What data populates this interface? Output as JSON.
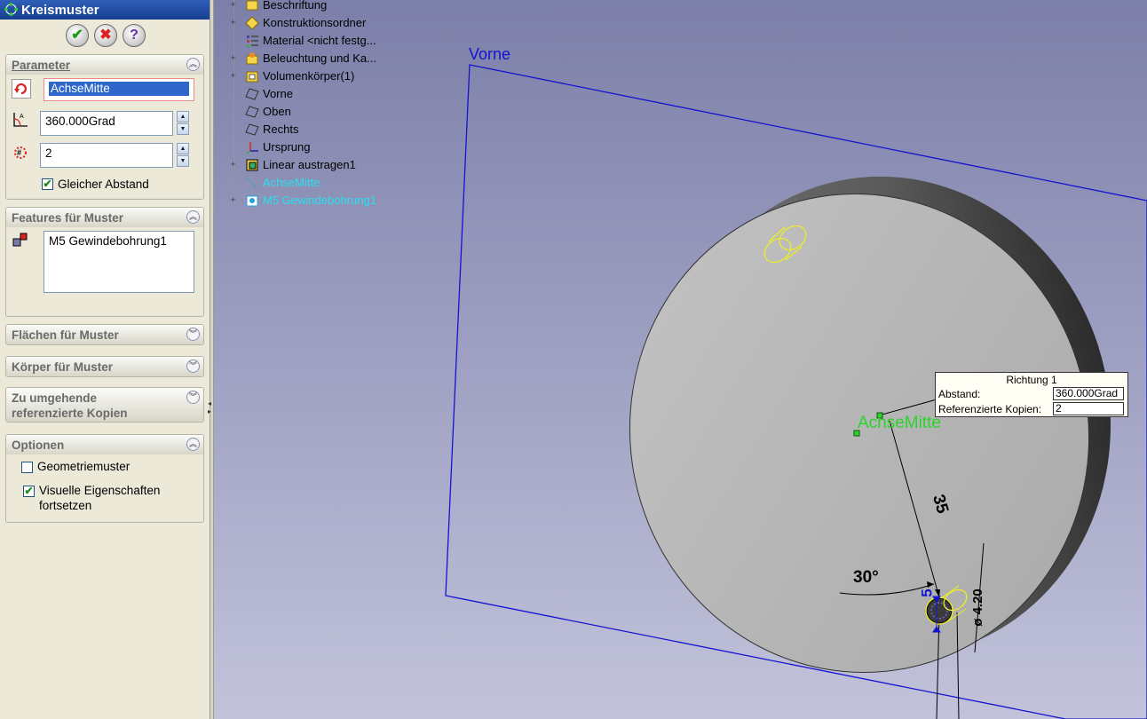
{
  "property_manager": {
    "title": "Kreismuster",
    "groups": {
      "parameter": {
        "label": "Parameter",
        "axis_value": "AchseMitte",
        "angle_value": "360.000Grad",
        "count_value": "2",
        "equal_spacing_label": "Gleicher Abstand",
        "equal_spacing_checked": true
      },
      "features": {
        "label": "Features für Muster",
        "items": [
          "M5 Gewindebohrung1"
        ]
      },
      "faces": {
        "label": "Flächen für Muster"
      },
      "bodies": {
        "label": "Körper für Muster"
      },
      "skip": {
        "label_line1": "Zu umgehende",
        "label_line2": "referenzierte Kopien"
      },
      "options": {
        "label": "Optionen",
        "geometry_pattern_label": "Geometriemuster",
        "geometry_pattern_checked": false,
        "visual_props_line1": "Visuelle Eigenschaften",
        "visual_props_line2": "fortsetzen",
        "visual_props_checked": true
      }
    }
  },
  "feature_tree": [
    {
      "label": "Beschriftung",
      "icon": "annotations-icon",
      "expandable": true
    },
    {
      "label": "Konstruktionsordner",
      "icon": "design-binder-icon",
      "expandable": true
    },
    {
      "label": "Material <nicht festg...",
      "icon": "material-icon",
      "expandable": false
    },
    {
      "label": "Beleuchtung und Ka...",
      "icon": "lights-cameras-icon",
      "expandable": true
    },
    {
      "label": "Volumenkörper(1)",
      "icon": "solid-bodies-icon",
      "expandable": true
    },
    {
      "label": "Vorne",
      "icon": "plane-icon",
      "expandable": false
    },
    {
      "label": "Oben",
      "icon": "plane-icon",
      "expandable": false
    },
    {
      "label": "Rechts",
      "icon": "plane-icon",
      "expandable": false
    },
    {
      "label": "Ursprung",
      "icon": "origin-icon",
      "expandable": false
    },
    {
      "label": "Linear austragen1",
      "icon": "extrude-icon",
      "expandable": true
    },
    {
      "label": "AchseMitte",
      "icon": "axis-icon",
      "expandable": false,
      "highlighted": true
    },
    {
      "label": "M5 Gewindebohrung1",
      "icon": "hole-wizard-icon",
      "expandable": true,
      "highlighted": true
    }
  ],
  "graphics": {
    "plane_label": "Vorne",
    "axis_label": "AchseMitte",
    "dim_radius": "35",
    "dim_angle": "30°",
    "dim_small": "5",
    "dim_dia": "ø 4.20",
    "callout": {
      "title": "Richtung 1",
      "distance_label": "Abstand:",
      "distance_value": "360.000Grad",
      "copies_label": "Referenzierte Kopien:",
      "copies_value": "2"
    },
    "colors": {
      "plane": "#1414d0",
      "highlight": "#28e0f0",
      "axis": "#2bd42b",
      "feature": "#f0f020"
    }
  }
}
